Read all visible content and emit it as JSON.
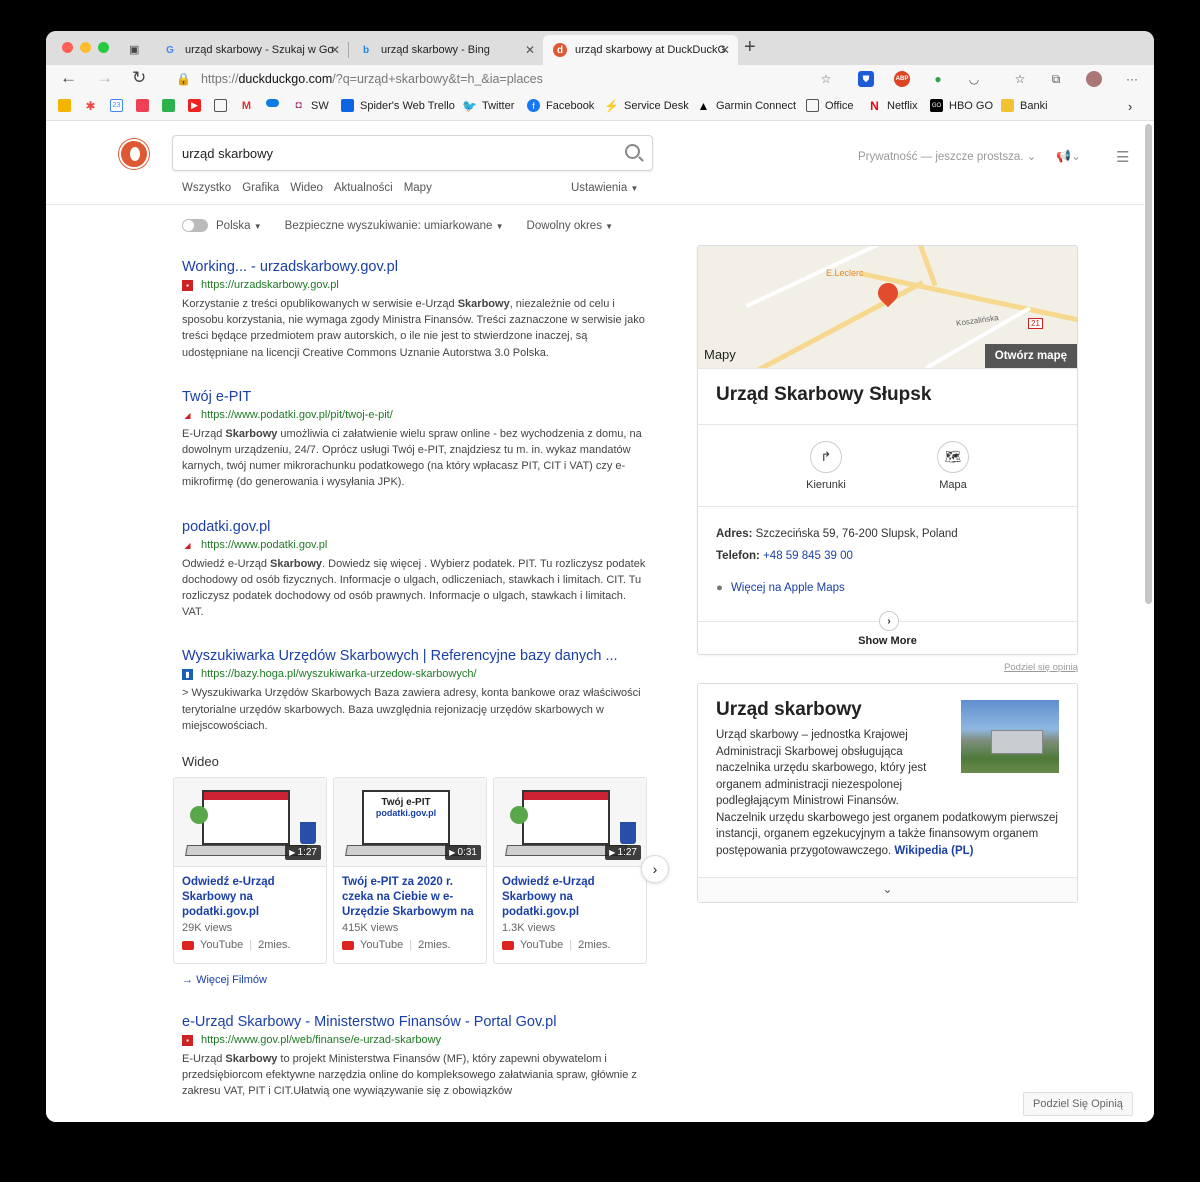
{
  "browser": {
    "tabs": [
      {
        "label": "urząd skarbowy - Szukaj w Go",
        "favicon": "google-favicon"
      },
      {
        "label": "urząd skarbowy - Bing",
        "favicon": "bing-favicon"
      },
      {
        "label": "urząd skarbowy at DuckDuckG",
        "favicon": "duckduckgo-favicon",
        "active": true
      }
    ],
    "url_prefix": "https://",
    "url_domain": "duckduckgo.com",
    "url_rest": "/?q=urząd+skarbowy&t=h_&ia=places",
    "bookmarks": [
      {
        "label": "SW",
        "icon": "bookmark-icon"
      },
      {
        "label": "Spider's Web Trello",
        "icon": "trello-icon"
      },
      {
        "label": "Twitter",
        "icon": "twitter-icon"
      },
      {
        "label": "Facebook",
        "icon": "facebook-icon"
      },
      {
        "label": "Service Desk",
        "icon": "service-desk-icon"
      },
      {
        "label": "Garmin Connect",
        "icon": "garmin-icon"
      },
      {
        "label": "Office",
        "icon": "document-icon"
      },
      {
        "label": "Netflix",
        "icon": "netflix-icon"
      },
      {
        "label": "HBO GO",
        "icon": "hbo-icon"
      },
      {
        "label": "Banki",
        "icon": "folder-icon"
      }
    ]
  },
  "header": {
    "query": "urząd skarbowy",
    "nav": [
      "Wszystko",
      "Grafika",
      "Wideo",
      "Aktualności",
      "Mapy"
    ],
    "settings": "Ustawienia",
    "privacy": "Prywatność — jeszcze prostsza."
  },
  "filters": {
    "region": "Polska",
    "safe_search": "Bezpieczne wyszukiwanie: umiarkowane",
    "time": "Dowolny okres"
  },
  "results": [
    {
      "title": "Working... - urzadskarbowy.gov.pl",
      "url": "https://urzadskarbowy.gov.pl",
      "snippet_pre": "Korzystanie z treści opublikowanych w serwisie e-Urząd ",
      "snippet_bold": "Skarbowy",
      "snippet_post": ", niezależnie od celu i sposobu korzystania, nie wymaga zgody Ministra Finansów. Treści zaznaczone w serwisie jako treści będące przedmiotem praw autorskich, o ile nie jest to stwierdzone inaczej, są udostępniane na licencji Creative Commons Uznanie Autorstwa 3.0 Polska."
    },
    {
      "title": "Twój e-PIT",
      "url": "https://www.podatki.gov.pl/pit/twoj-e-pit/",
      "snippet_pre": "E-Urząd ",
      "snippet_bold": "Skarbowy",
      "snippet_post": " umożliwia ci załatwienie wielu spraw online - bez wychodzenia z domu, na dowolnym urządzeniu, 24/7. Oprócz usługi Twój e-PIT, znajdziesz tu m. in. wykaz mandatów karnych, twój numer mikrorachunku podatkowego (na który wpłacasz PIT, CIT i VAT) czy e-mikrofirmę (do generowania i wysyłania JPK)."
    },
    {
      "title": "podatki.gov.pl",
      "url": "https://www.podatki.gov.pl",
      "snippet_pre": "Odwiedź e-Urząd ",
      "snippet_bold": "Skarbowy",
      "snippet_post": ". Dowiedz się więcej . Wybierz podatek. PIT. Tu rozliczysz podatek dochodowy od osób fizycznych. Informacje o ulgach, odliczeniach, stawkach i limitach. CIT. Tu rozliczysz podatek dochodowy od osób prawnych. Informacje o ulgach, stawkach i limitach. VAT."
    },
    {
      "title": "Wyszukiwarka Urzędów Skarbowych | Referencyjne bazy danych ...",
      "url": "https://bazy.hoga.pl/wyszukiwarka-urzedow-skarbowych/",
      "snippet_pre": "> Wyszukiwarka Urzędów Skarbowych Baza zawiera adresy, konta bankowe oraz właściwości terytorialne urzędów skarbowych. Baza uwzględnia rejonizację urzędów skarbowych w miejscowościach.",
      "snippet_bold": "",
      "snippet_post": ""
    }
  ],
  "videos": {
    "heading": "Wideo",
    "more": "Więcej Filmów",
    "items": [
      {
        "title": "Odwiedź e-Urząd Skarbowy na podatki.gov.pl",
        "views": "29K views",
        "source": "YouTube",
        "age": "2mies.",
        "duration": "1:27"
      },
      {
        "title": "Twój e-PIT za 2020 r. czeka na Ciebie w e-Urzędzie Skarbowym na",
        "views": "415K views",
        "source": "YouTube",
        "age": "2mies.",
        "duration": "0:31"
      },
      {
        "title": "Odwiedź e-Urząd Skarbowy na podatki.gov.pl",
        "views": "1.3K views",
        "source": "YouTube",
        "age": "2mies.",
        "duration": "1:27"
      }
    ],
    "thumb_text_1": "Twój e-PIT",
    "thumb_text_2": "podatki.gov.pl"
  },
  "result_last": {
    "title": "e-Urząd Skarbowy - Ministerstwo Finansów - Portal Gov.pl",
    "url": "https://www.gov.pl/web/finanse/e-urzad-skarbowy",
    "snippet_pre": "E-Urząd ",
    "snippet_bold": "Skarbowy",
    "snippet_post": " to projekt Ministerstwa Finansów (MF), który zapewni obywatelom i przedsiębiorcom efektywne narzędzia online do kompleksowego załatwiania spraw, głównie z zakresu VAT, PIT i CIT.Ułatwią one wywiązywanie się z obowiązków"
  },
  "place": {
    "map_brand": "Mapy",
    "open_map": "Otwórz mapę",
    "map_poi": "E.Leclerc",
    "map_street": "Koszalińska",
    "map_route": "21",
    "title": "Urząd Skarbowy Słupsk",
    "directions": "Kierunki",
    "map": "Mapa",
    "address_label": "Adres:",
    "address": "Szczecińska 59, 76-200 Slupsk, Poland",
    "phone_label": "Telefon:",
    "phone": "+48 59 845 39 00",
    "apple_maps": "Więcej na Apple Maps",
    "show_more": "Show More",
    "share": "Podziel się opinią"
  },
  "wiki": {
    "title": "Urząd skarbowy",
    "text_narrow": "Urząd skarbowy – jednostka Krajowej Administracji Skarbowej obsługująca naczelnika urzędu skarbowego, który jest organem administracji niezespolonej podległającym Ministrowi Finansów.",
    "text_wide": "Naczelnik urzędu skarbowego jest organem podatkowym pierwszej instancji, organem egzekucyjnym a także finansowym organem postępowania przygotowawczego.",
    "link": "Wikipedia (PL)"
  },
  "feedback": "Podziel Się Opinią"
}
